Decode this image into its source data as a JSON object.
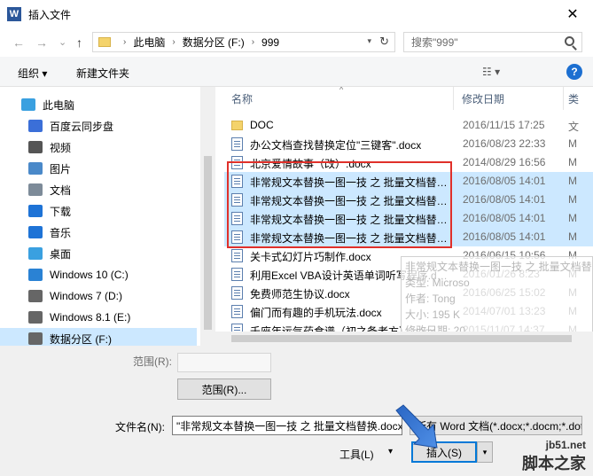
{
  "window": {
    "title": "插入文件",
    "app_icon_letter": "W",
    "close_glyph": "✕"
  },
  "nav": {
    "back": "←",
    "forward": "→",
    "dropdown": "⌄",
    "up": "↑",
    "breadcrumbs": [
      "此电脑",
      "数据分区 (F:)",
      "999"
    ],
    "search_placeholder": "搜索\"999\""
  },
  "toolbar": {
    "organize_label": "组织 ▾",
    "new_folder_label": "新建文件夹",
    "view_glyph": "☷ ▾",
    "help_glyph": "?"
  },
  "sidebar": {
    "items": [
      {
        "label": "此电脑",
        "icon": "computer-icon",
        "color": "#3aa0e0"
      },
      {
        "label": "百度云同步盘",
        "icon": "cloud-sync-icon",
        "color": "#3b6fd8"
      },
      {
        "label": "视频",
        "icon": "video-icon",
        "color": "#555555"
      },
      {
        "label": "图片",
        "icon": "pictures-icon",
        "color": "#4a89c9"
      },
      {
        "label": "文档",
        "icon": "documents-icon",
        "color": "#7d8b99"
      },
      {
        "label": "下载",
        "icon": "download-icon",
        "color": "#1e73d6"
      },
      {
        "label": "音乐",
        "icon": "music-icon",
        "color": "#1e73d6"
      },
      {
        "label": "桌面",
        "icon": "desktop-icon",
        "color": "#3aa0e0"
      },
      {
        "label": "Windows 10 (C:)",
        "icon": "windows-drive-icon",
        "color": "#2a82d4"
      },
      {
        "label": "Windows 7 (D:)",
        "icon": "drive-icon",
        "color": "#666666"
      },
      {
        "label": "Windows 8.1 (E:)",
        "icon": "drive-icon",
        "color": "#666666"
      },
      {
        "label": "数据分区 (F:)",
        "icon": "drive-icon",
        "color": "#666666",
        "selected": true
      }
    ]
  },
  "columns": {
    "name": "名称",
    "date": "修改日期",
    "type": "类"
  },
  "files": [
    {
      "name": "DOC",
      "date": "2016/11/15 17:25",
      "type": "文",
      "kind": "folder",
      "selected": false
    },
    {
      "name": "办公文档查找替换定位\"三键客\".docx",
      "date": "2016/08/23 22:33",
      "type": "M",
      "kind": "doc",
      "selected": false
    },
    {
      "name": "北京爱情故事（改）.docx",
      "date": "2014/08/29 16:56",
      "type": "M",
      "kind": "doc",
      "selected": false
    },
    {
      "name": "非常规文本替换一图一技 之 批量文档替换.docx",
      "date": "2016/08/05 14:01",
      "type": "M",
      "kind": "doc",
      "selected": true
    },
    {
      "name": "非常规文本替换一图一技 之 批量文档替换.docx",
      "date": "2016/08/05 14:01",
      "type": "M",
      "kind": "doc",
      "selected": true
    },
    {
      "name": "非常规文本替换一图一技 之 批量文档替换.docx",
      "date": "2016/08/05 14:01",
      "type": "M",
      "kind": "doc",
      "selected": true
    },
    {
      "name": "非常规文本替换一图一技 之 批量文档替换.docx",
      "date": "2016/08/05 14:01",
      "type": "M",
      "kind": "doc",
      "selected": true
    },
    {
      "name": "关卡式幻灯片巧制作.docx",
      "date": "2016/06/15 10:56",
      "type": "M",
      "kind": "doc",
      "selected": false
    },
    {
      "name": "利用Excel VBA设计英语单词听写程序.docx",
      "date": "2016/01/26 8:23",
      "type": "M",
      "kind": "doc",
      "selected": false
    },
    {
      "name": "免费师范生协议.docx",
      "date": "2016/06/25 15:02",
      "type": "M",
      "kind": "doc",
      "selected": false
    },
    {
      "name": "偏门而有趣的手机玩法.docx",
      "date": "2014/07/01 13:23",
      "type": "M",
      "kind": "doc",
      "selected": false
    },
    {
      "name": "千座年运气药食谱（初之备老方）.docx",
      "date": "2015/11/07 14:37",
      "type": "M",
      "kind": "doc",
      "selected": false
    }
  ],
  "tooltip": {
    "lines": [
      "非常规文本替换一图一技 之 批量文档替",
      "类型: Microso",
      "作者: Tong",
      "大小: 195 K",
      "修改日期: 20"
    ]
  },
  "options": {
    "range_label": "范围(R):",
    "range_button": "范围(R)..."
  },
  "filename": {
    "label": "文件名(N):",
    "value": "\"非常规文本替换一图一技 之 批量文档替换.docx\" \"非常规文本替换一图一技 之 批量文档替换.docx\"",
    "type_value": "所有 Word 文档(*.docx;*.docm;*.dotx)"
  },
  "actions": {
    "tools_label": "工具(L)",
    "tools_dd": "▾",
    "insert_label": "插入(S)",
    "insert_dd": "▾"
  },
  "watermark": {
    "site": "jb51.net",
    "name": "脚本之家"
  }
}
